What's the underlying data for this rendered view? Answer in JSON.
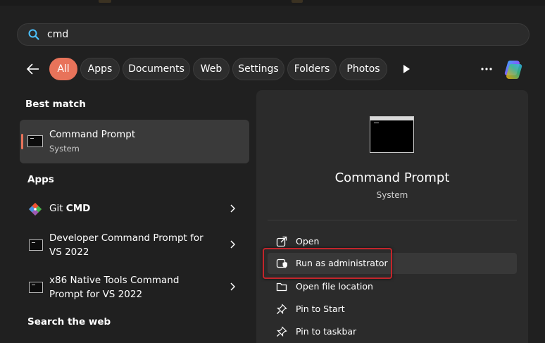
{
  "search": {
    "query": "cmd"
  },
  "filters": {
    "back_label": "Back",
    "chips": [
      "All",
      "Apps",
      "Documents",
      "Web",
      "Settings",
      "Folders",
      "Photos"
    ],
    "active_chip": "All"
  },
  "results": {
    "best_match_title": "Best match",
    "best_match": {
      "title": "Command Prompt",
      "subtitle": "System"
    },
    "apps_title": "Apps",
    "apps": [
      {
        "title_plain": "Git ",
        "title_bold": "CMD",
        "icon": "git-icon"
      },
      {
        "title_line1": "Developer Command Prompt for",
        "title_line2": "VS 2022",
        "icon": "cmd-icon"
      },
      {
        "title_line1": "x86 Native Tools Command",
        "title_line2": "Prompt for VS 2022",
        "icon": "cmd-icon"
      }
    ],
    "web_title": "Search the web"
  },
  "preview": {
    "title": "Command Prompt",
    "subtitle": "System",
    "actions": [
      {
        "label": "Open",
        "icon": "open-external-icon"
      },
      {
        "label": "Run as administrator",
        "icon": "shield-admin-icon"
      },
      {
        "label": "Open file location",
        "icon": "folder-icon"
      },
      {
        "label": "Pin to Start",
        "icon": "pin-icon"
      },
      {
        "label": "Pin to taskbar",
        "icon": "pin-icon"
      }
    ]
  },
  "colors": {
    "accent": "#e8735a",
    "highlight_box": "#c3252b",
    "background": "#202020",
    "panel": "#2b2b2b"
  }
}
